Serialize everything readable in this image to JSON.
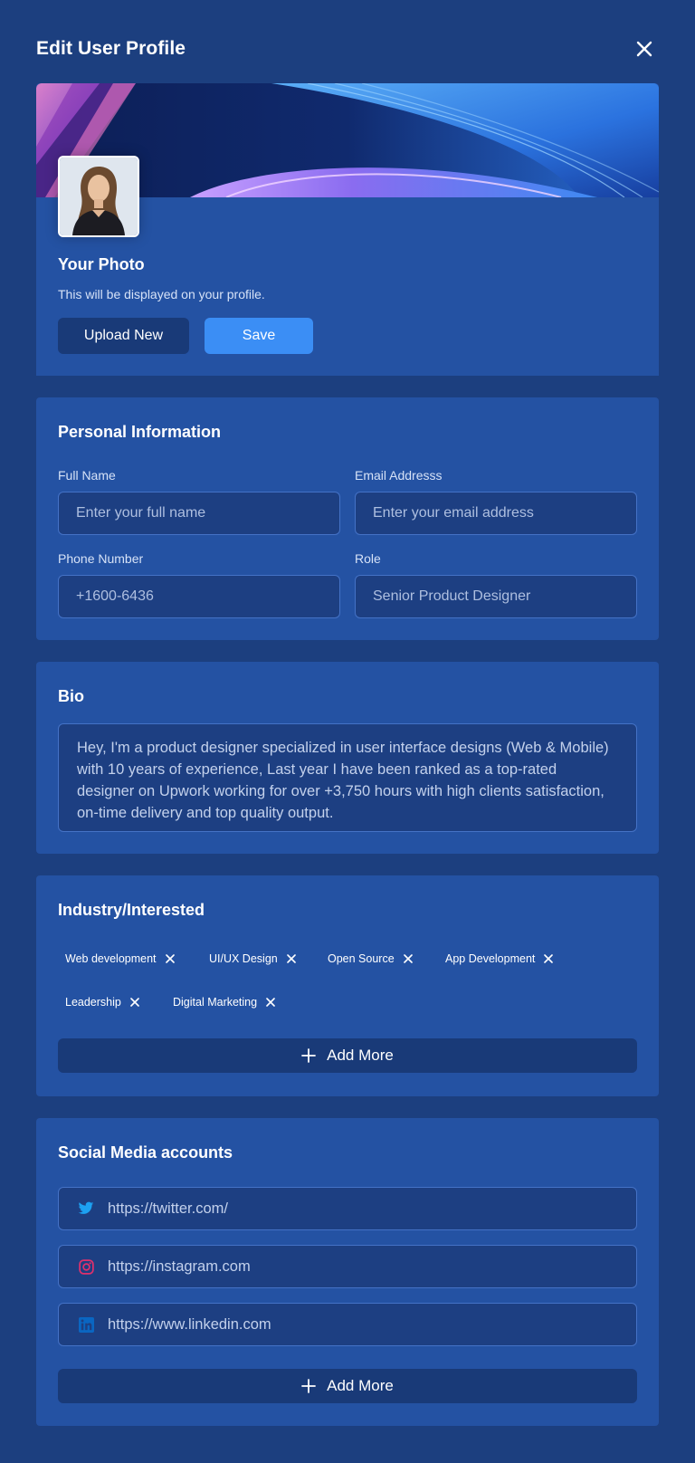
{
  "header": {
    "title": "Edit User Profile",
    "close_icon": "close-icon"
  },
  "photo": {
    "title": "Your Photo",
    "subtitle": "This will be displayed on your profile.",
    "upload_label": "Upload New",
    "save_label": "Save"
  },
  "personal": {
    "title": "Personal Information",
    "full_name": {
      "label": "Full Name",
      "placeholder": "Enter your full name"
    },
    "email": {
      "label": "Email Addresss",
      "placeholder": "Enter your email address"
    },
    "phone": {
      "label": "Phone Number",
      "value": "+1600-6436"
    },
    "role": {
      "label": "Role",
      "value": "Senior Product Designer"
    }
  },
  "bio": {
    "title": "Bio",
    "text": "Hey, I'm a product designer specialized in user interface designs (Web & Mobile) with 10 years of experience, Last year I have been ranked as a top-rated designer on Upwork working for over +3,750 hours with high clients satisfaction, on-time delivery and top quality output."
  },
  "industry": {
    "title": "Industry/Interested",
    "tags": [
      "Web development",
      "UI/UX Design",
      "Open Source",
      "App Development",
      "Leadership",
      "Digital Marketing"
    ],
    "add_more": "Add More"
  },
  "social": {
    "title": "Social Media accounts",
    "accounts": [
      {
        "icon": "twitter-icon",
        "url": "https://twitter.com/"
      },
      {
        "icon": "instagram-icon",
        "url": "https://instagram.com"
      },
      {
        "icon": "linkedin-icon",
        "url": "https://www.linkedin.com"
      }
    ],
    "add_more": "Add More"
  },
  "colors": {
    "background": "#1c3f7f",
    "card": "#2452a3",
    "input": "#1d3f82",
    "primary": "#3b8ef5",
    "twitter": "#1da1f2",
    "instagram": "#e1306c",
    "linkedin": "#0a66c2"
  }
}
